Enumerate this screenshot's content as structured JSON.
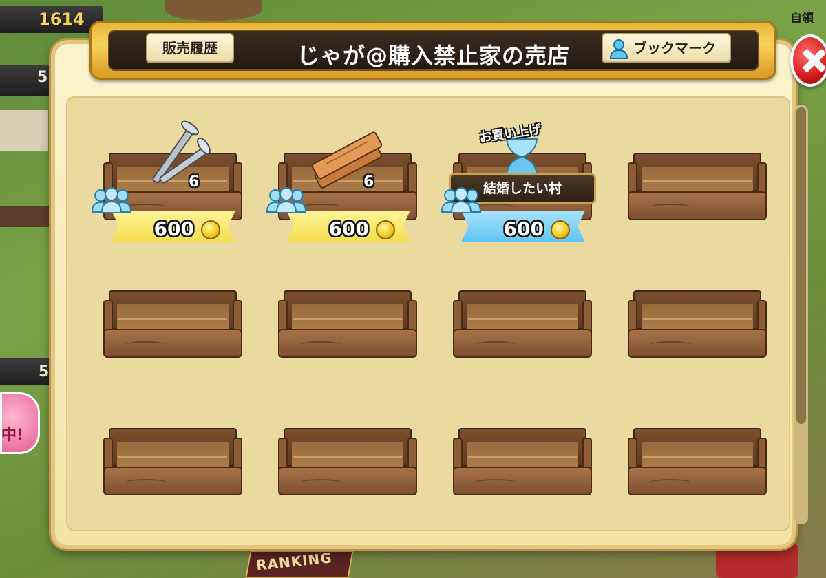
{
  "background": {
    "hud_value": "1614",
    "hud_value2": "5",
    "hud_value3": "5",
    "right_label": "自領",
    "ranking_label": "RANKING",
    "sign_text": "中!"
  },
  "header": {
    "title": "じゃが@購入禁止家の売店",
    "history_button": "販売履歴",
    "bookmark_button": "ブックマーク"
  },
  "colors": {
    "title_gold": "#f7d25c",
    "close_red": "#d41818",
    "price_yellow": "#f3dd4a",
    "price_blue": "#5fc3ef"
  },
  "slots": [
    {
      "item": "nails-icon",
      "quantity": "6",
      "price": "600",
      "state": "for_sale"
    },
    {
      "item": "wood-planks-icon",
      "quantity": "6",
      "price": "600",
      "state": "for_sale"
    },
    {
      "item": "hourglass-icon",
      "price": "600",
      "state": "sold",
      "sold_label": "お買い上げ",
      "buyer": "結婚したい村"
    },
    {
      "state": "empty"
    },
    {
      "state": "empty"
    },
    {
      "state": "empty"
    },
    {
      "state": "empty"
    },
    {
      "state": "empty"
    },
    {
      "state": "empty"
    },
    {
      "state": "empty"
    },
    {
      "state": "empty"
    },
    {
      "state": "empty"
    }
  ]
}
